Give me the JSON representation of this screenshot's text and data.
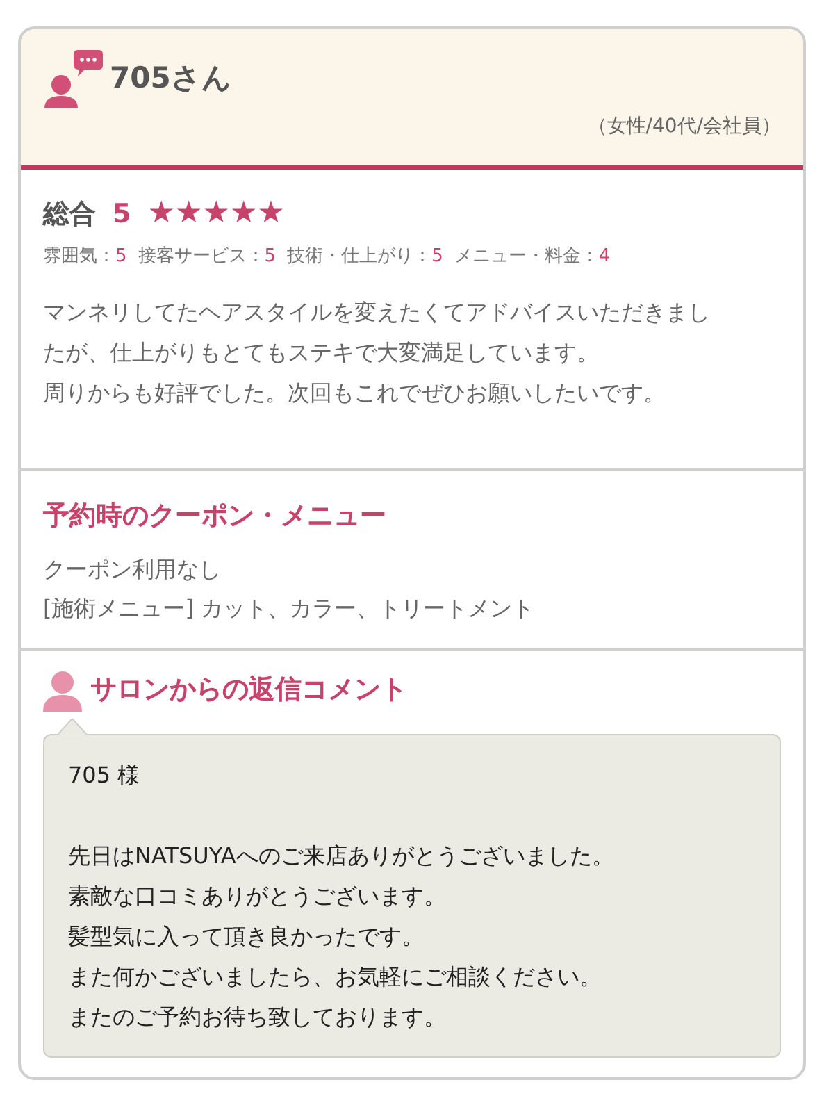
{
  "reviewer": {
    "name": "705さん",
    "profile": "（女性/40代/会社員）"
  },
  "overall": {
    "label": "総合",
    "score": "5",
    "stars": 5
  },
  "ratings": [
    {
      "label": "雰囲気：",
      "score": "5"
    },
    {
      "label": "接客サービス：",
      "score": "5"
    },
    {
      "label": "技術・仕上がり：",
      "score": "5"
    },
    {
      "label": "メニュー・料金：",
      "score": "4"
    }
  ],
  "comment": [
    "マンネリしてたヘアスタイルを変えたくてアドバイスいただきましたが、仕上がりもとてもステキで大変満足しています。",
    "周りからも好評でした。次回もこれでぜひお願いしたいです。"
  ],
  "coupon": {
    "title": "予約時のクーポン・メニュー",
    "lines": [
      "クーポン利用なし",
      "[施術メニュー] カット、カラー、トリートメント"
    ]
  },
  "reply": {
    "title": "サロンからの返信コメント",
    "greeting": "705 様",
    "lines": [
      "先日はNATSUYAへのご来店ありがとうございました。",
      "素敵な口コミありがとうございます。",
      "髪型気に入って頂き良かったです。",
      "また何かございましたら、お気軽にご相談ください。",
      "またのご予約お待ち致しております。"
    ]
  }
}
